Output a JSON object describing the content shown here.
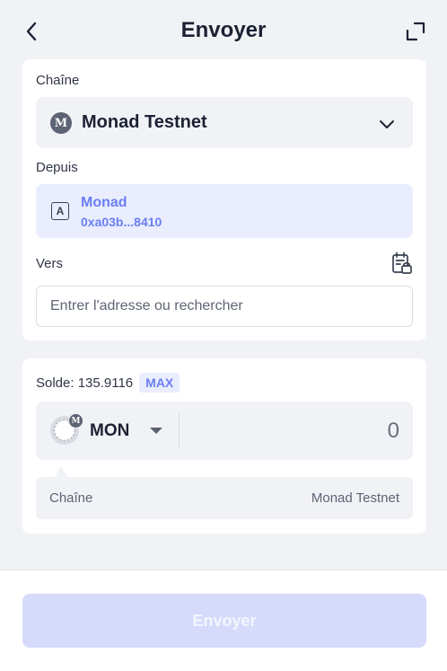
{
  "header": {
    "title": "Envoyer",
    "back_icon": "chevron-left-icon",
    "expand_icon": "expand-icon"
  },
  "chain_section": {
    "label": "Chaîne",
    "selected_chain": "Monad Testnet",
    "logo_letter": "M",
    "dropdown_icon": "chevron-down-icon"
  },
  "from_section": {
    "label": "Depuis",
    "account_icon_letter": "A",
    "account_name": "Monad",
    "account_address": "0xa03b...8410"
  },
  "to_section": {
    "label": "Vers",
    "addressbook_icon": "address-book-icon",
    "input_value": "",
    "input_placeholder": "Entrer l'adresse ou rechercher"
  },
  "amount_section": {
    "balance_text": "Solde: 135.9116",
    "max_label": "MAX",
    "token_symbol": "MON",
    "token_badge_letter": "M",
    "amount_value": "0",
    "chain_info_label": "Chaîne",
    "chain_info_value": "Monad Testnet"
  },
  "footer": {
    "send_label": "Envoyer"
  },
  "colors": {
    "accent": "#6b7ef2",
    "accent_bg": "#e9edfd",
    "disabled_button": "#d6dbfb",
    "page_bg": "#f1f2f6"
  }
}
